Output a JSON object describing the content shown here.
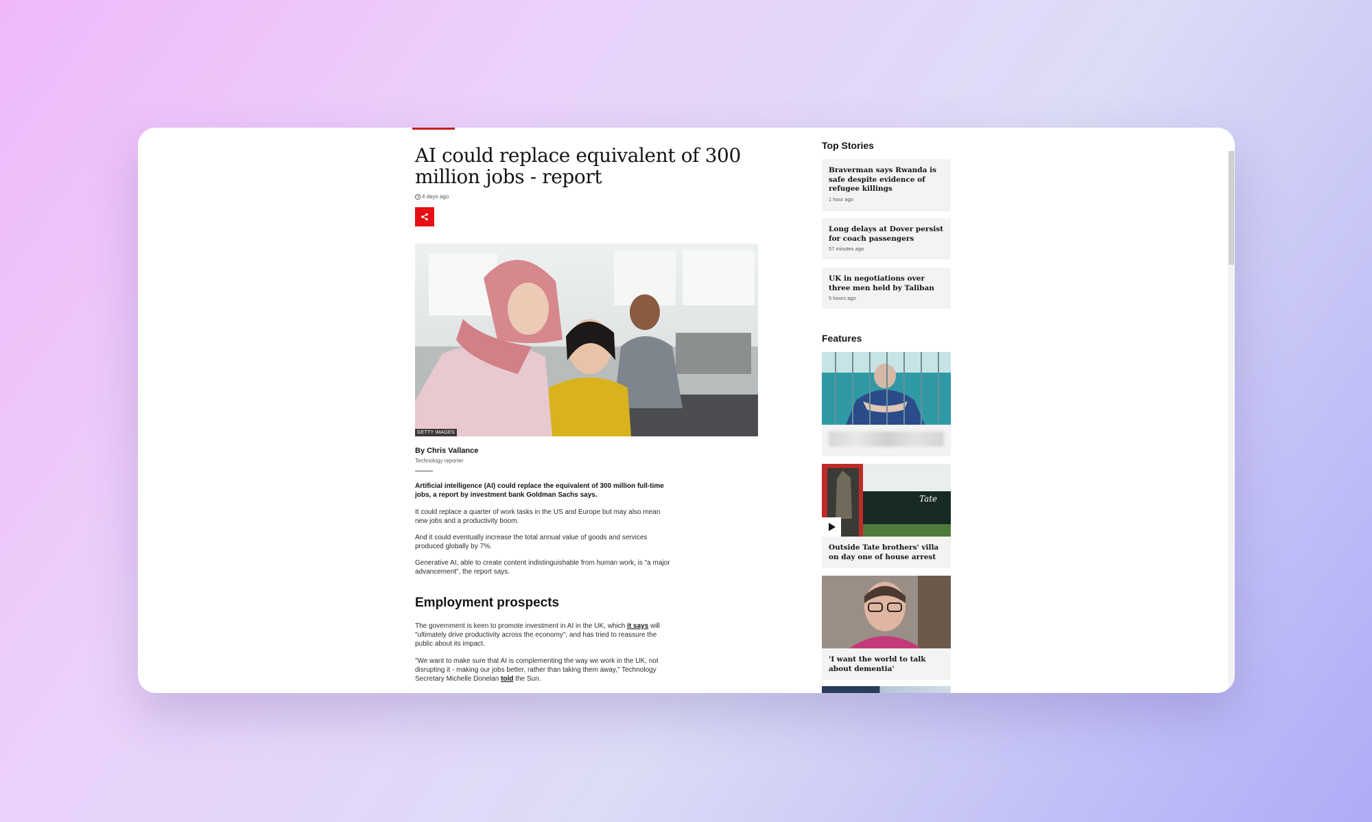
{
  "article": {
    "headline": "AI could replace equivalent of 300 million jobs - report",
    "timestamp": "4 days ago",
    "image_credit": "GETTY IMAGES",
    "byline": "By Chris Vallance",
    "byline_role": "Technology reporter",
    "intro": "Artificial intelligence (AI) could replace the equivalent of 300 million full-time jobs, a report by investment bank Goldman Sachs says.",
    "p1": "It could replace a quarter of work tasks in the US and Europe but may also mean new jobs and a productivity boom.",
    "p2": "And it could eventually increase the total annual value of goods and services produced globally by 7%.",
    "p3": "Generative AI, able to create content indistinguishable from human work, is \"a major advancement\", the report says.",
    "subheading": "Employment prospects",
    "p4_before": "The government is keen to promote investment in AI in the UK, which ",
    "p4_link": "it says",
    "p4_after": " will \"ultimately drive productivity across the economy\", and has tried to reassure the public about its impact.",
    "p5_before": "\"We want to make sure that AI is complementing the way we work in the UK, not disrupting it - making our jobs better, rather than taking them away,\" Technology Secretary Michelle Donelan ",
    "p5_link": "told",
    "p5_after": " the Sun."
  },
  "sidebar": {
    "top_stories_title": "Top Stories",
    "top_stories": [
      {
        "title": "Braverman says Rwanda is safe despite evidence of refugee killings",
        "time": "1 hour ago"
      },
      {
        "title": "Long delays at Dover persist for coach passengers",
        "time": "57 minutes ago"
      },
      {
        "title": "UK in negotiations over three men held by Taliban",
        "time": "5 hours ago"
      }
    ],
    "features_title": "Features",
    "features": [
      {
        "caption": ""
      },
      {
        "caption": "Outside Tate brothers' villa on day one of house arrest",
        "sign": "Tate"
      },
      {
        "caption": "'I want the world to talk about dementia'"
      }
    ]
  },
  "colors": {
    "accent_red": "#e50f14",
    "card_bg": "#f3f3f3",
    "text_dark": "#141414"
  }
}
